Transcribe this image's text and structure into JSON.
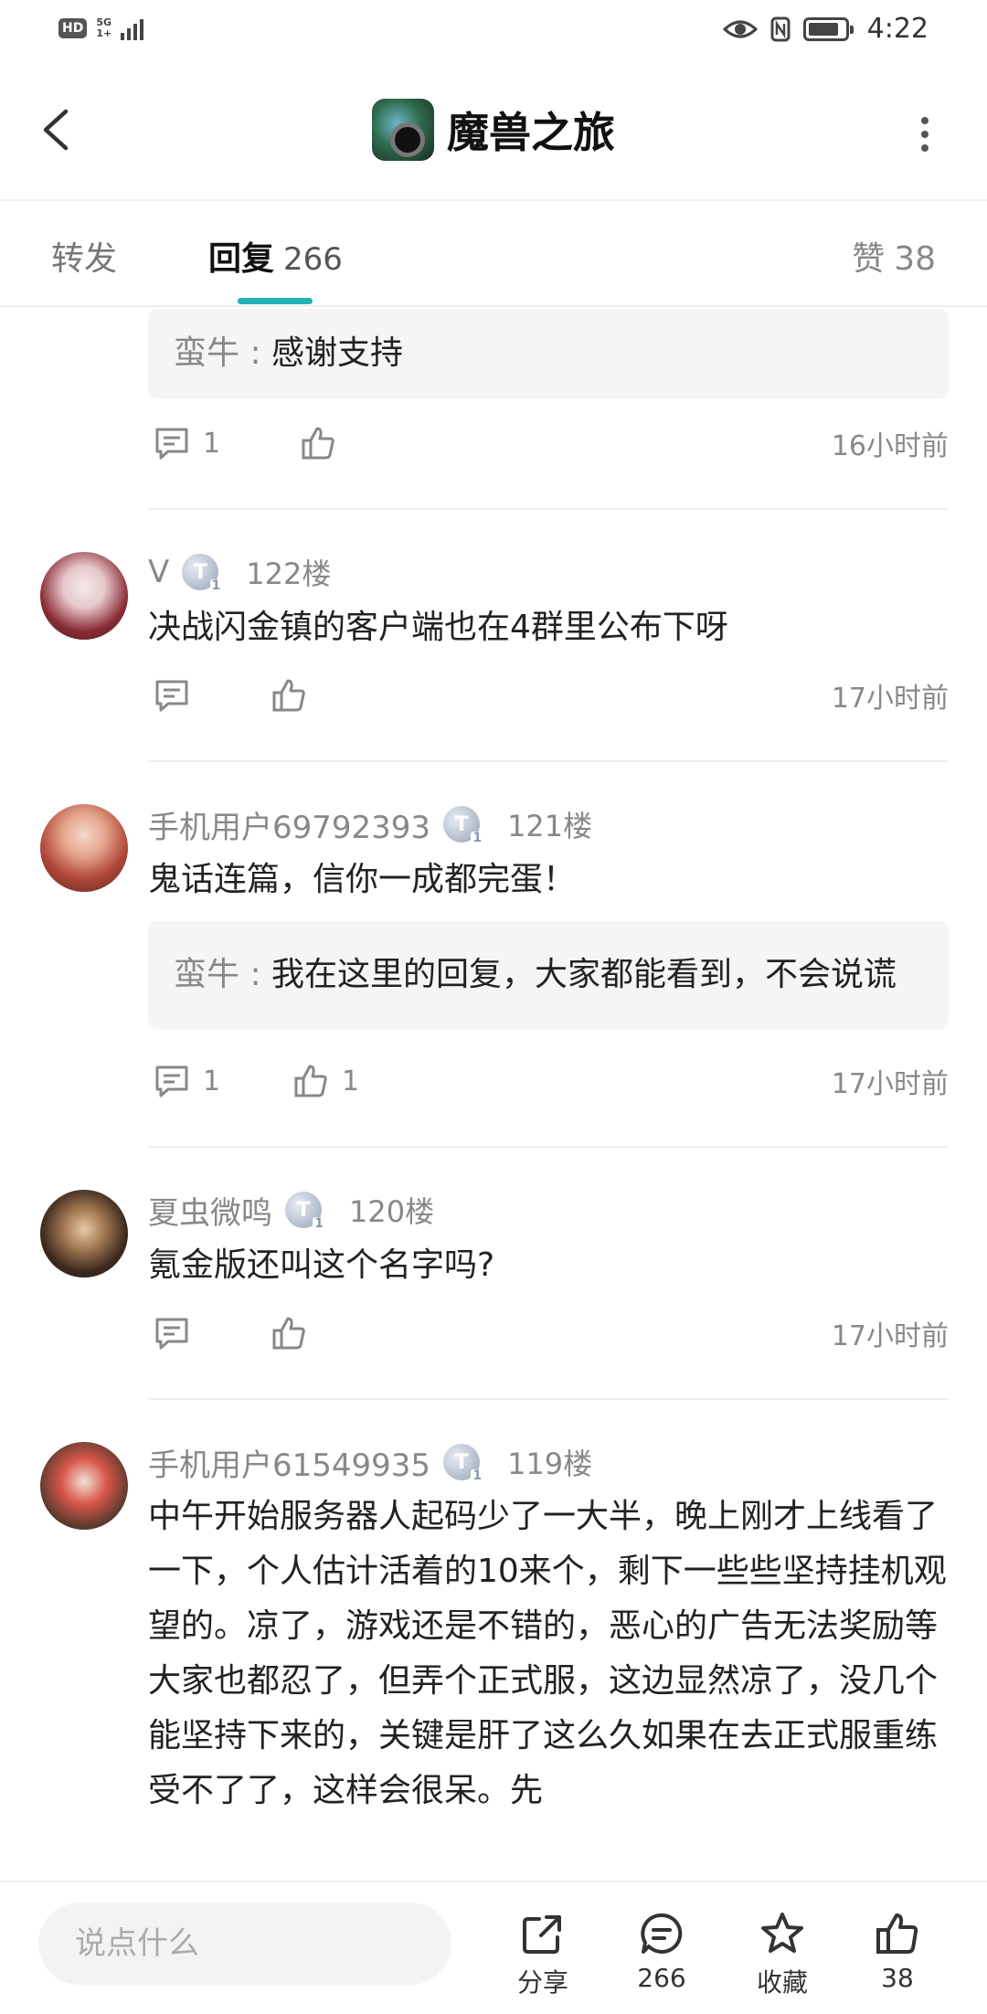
{
  "status_bar": {
    "hd": "HD",
    "network": "5G",
    "network_sub": "1+",
    "time": "4:22"
  },
  "header": {
    "title": "魔兽之旅"
  },
  "tabs": {
    "forward_label": "转发",
    "reply_label": "回复",
    "reply_count": "266",
    "like_label": "赞",
    "like_count": "38"
  },
  "comments": [
    {
      "quote_name": "蛮牛",
      "quote_text": "感谢支持",
      "reply_count": "1",
      "like_count": "",
      "time": "16小时前"
    },
    {
      "user": "V",
      "badge": "T",
      "floor": "122楼",
      "text": "决战闪金镇的客户端也在4群里公布下呀",
      "reply_count": "",
      "like_count": "",
      "time": "17小时前"
    },
    {
      "user": "手机用户69792393",
      "badge": "T",
      "floor": "121楼",
      "text": "鬼话连篇，信你一成都完蛋！",
      "quote_name": "蛮牛",
      "quote_text": "我在这里的回复，大家都能看到，不会说谎",
      "reply_count": "1",
      "like_count": "1",
      "time": "17小时前"
    },
    {
      "user": "夏虫微鸣",
      "badge": "T",
      "floor": "120楼",
      "text": "氪金版还叫这个名字吗?",
      "reply_count": "",
      "like_count": "",
      "time": "17小时前"
    },
    {
      "user": "手机用户61549935",
      "badge": "T",
      "floor": "119楼",
      "text": "中午开始服务器人起码少了一大半，晚上刚才上线看了一下，个人估计活着的10来个，剩下一些些坚持挂机观望的。凉了，游戏还是不错的，恶心的广告无法奖励等大家也都忍了，但弄个正式服，这边显然凉了，没几个能坚持下来的，关键是肝了这么久如果在去正式服重练受不了了，这样会很呆。先"
    }
  ],
  "bottom_bar": {
    "input_placeholder": "说点什么",
    "share_label": "分享",
    "comment_count": "266",
    "favorite_label": "收藏",
    "like_count": "38"
  },
  "colors": {
    "accent": "#22b1b5"
  }
}
